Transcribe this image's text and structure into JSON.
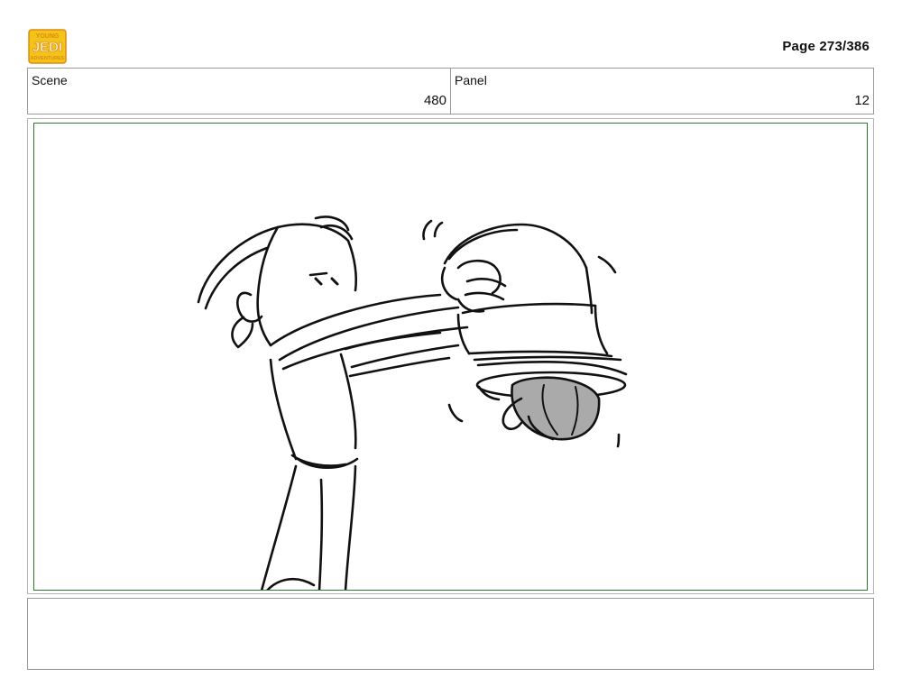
{
  "header": {
    "logo_icon": "young-jedi-adventures-logo",
    "logo_lines": [
      "YOUNG",
      "JEDI",
      "ADVENTURES"
    ],
    "page_label": "Page 273/386"
  },
  "info": {
    "scene_label": "Scene",
    "scene_value": "480",
    "panel_label": "Panel",
    "panel_value": "12"
  },
  "panel": {
    "frame_color": "#2f7a2f",
    "sketch_description_icon": "storyboard-sketch"
  },
  "notes": {
    "text": ""
  },
  "colors": {
    "logo_yellow": "#f2c419",
    "logo_orange": "#e08a12",
    "border_gray": "#9a9a9a"
  }
}
